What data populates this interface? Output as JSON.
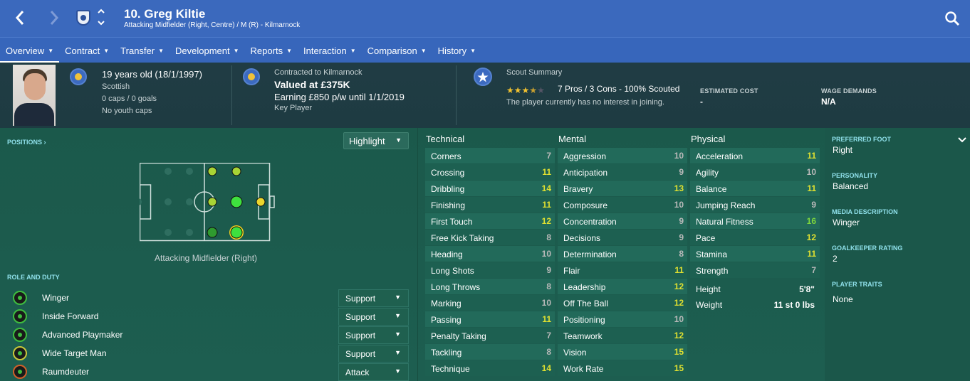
{
  "header": {
    "title": "10. Greg Kiltie",
    "subtitle": "Attacking Midfielder (Right, Centre) / M (R) - Kilmarnock",
    "back_icon": "chevron-left-icon",
    "forward_icon": "chevron-right-icon"
  },
  "tabs": [
    {
      "label": "Overview"
    },
    {
      "label": "Contract"
    },
    {
      "label": "Transfer"
    },
    {
      "label": "Development"
    },
    {
      "label": "Reports"
    },
    {
      "label": "Interaction"
    },
    {
      "label": "Comparison"
    },
    {
      "label": "History"
    }
  ],
  "info": {
    "age": "19 years old (18/1/1997)",
    "nationality": "Scottish",
    "caps": "0 caps / 0 goals",
    "youth_caps": "No youth caps",
    "contracted": "Contracted to Kilmarnock",
    "value": "Valued at £375K",
    "earning": "Earning £850 p/w until 1/1/2019",
    "status": "Key Player",
    "scout_title": "Scout Summary",
    "scout_rating": 3.5,
    "scout_rating_max": 5,
    "scout_line": "7 Pros / 3 Cons - 100% Scouted",
    "interest": "The player currently has no interest in joining.",
    "estimated_cost_label": "ESTIMATED COST",
    "estimated_cost": "-",
    "wage_label": "WAGE DEMANDS",
    "wage": "N/A"
  },
  "positions": {
    "header": "POSITIONS",
    "highlight": "Highlight",
    "caption": "Attacking Midfielder (Right)"
  },
  "roles": {
    "header": "ROLE AND DUTY",
    "items": [
      {
        "name": "Winger",
        "duty": "Support"
      },
      {
        "name": "Inside Forward",
        "duty": "Support"
      },
      {
        "name": "Advanced Playmaker",
        "duty": "Support"
      },
      {
        "name": "Wide Target Man",
        "duty": "Support"
      },
      {
        "name": "Raumdeuter",
        "duty": "Attack"
      }
    ]
  },
  "attributes": {
    "technical_label": "Technical",
    "mental_label": "Mental",
    "physical_label": "Physical",
    "technical": [
      {
        "name": "Corners",
        "value": "7"
      },
      {
        "name": "Crossing",
        "value": "11"
      },
      {
        "name": "Dribbling",
        "value": "14"
      },
      {
        "name": "Finishing",
        "value": "11"
      },
      {
        "name": "First Touch",
        "value": "12"
      },
      {
        "name": "Free Kick Taking",
        "value": "8"
      },
      {
        "name": "Heading",
        "value": "10"
      },
      {
        "name": "Long Shots",
        "value": "9"
      },
      {
        "name": "Long Throws",
        "value": "8"
      },
      {
        "name": "Marking",
        "value": "10"
      },
      {
        "name": "Passing",
        "value": "11"
      },
      {
        "name": "Penalty Taking",
        "value": "7"
      },
      {
        "name": "Tackling",
        "value": "8"
      },
      {
        "name": "Technique",
        "value": "14"
      }
    ],
    "mental": [
      {
        "name": "Aggression",
        "value": "10"
      },
      {
        "name": "Anticipation",
        "value": "9"
      },
      {
        "name": "Bravery",
        "value": "13"
      },
      {
        "name": "Composure",
        "value": "10"
      },
      {
        "name": "Concentration",
        "value": "9"
      },
      {
        "name": "Decisions",
        "value": "9"
      },
      {
        "name": "Determination",
        "value": "8"
      },
      {
        "name": "Flair",
        "value": "11"
      },
      {
        "name": "Leadership",
        "value": "12"
      },
      {
        "name": "Off The Ball",
        "value": "12"
      },
      {
        "name": "Positioning",
        "value": "10"
      },
      {
        "name": "Teamwork",
        "value": "12"
      },
      {
        "name": "Vision",
        "value": "15"
      },
      {
        "name": "Work Rate",
        "value": "15"
      }
    ],
    "physical": [
      {
        "name": "Acceleration",
        "value": "11"
      },
      {
        "name": "Agility",
        "value": "10"
      },
      {
        "name": "Balance",
        "value": "11"
      },
      {
        "name": "Jumping Reach",
        "value": "9"
      },
      {
        "name": "Natural Fitness",
        "value": "16"
      },
      {
        "name": "Pace",
        "value": "12"
      },
      {
        "name": "Stamina",
        "value": "11"
      },
      {
        "name": "Strength",
        "value": "7"
      }
    ],
    "height_label": "Height",
    "height": "5'8\"",
    "weight_label": "Weight",
    "weight": "11 st 0 lbs"
  },
  "right_panel": {
    "preferred_foot_label": "PREFERRED FOOT",
    "preferred_foot": "Right",
    "personality_label": "PERSONALITY",
    "personality": "Balanced",
    "media_label": "MEDIA DESCRIPTION",
    "media": "Winger",
    "gk_label": "GOALKEEPER RATING",
    "gk": "2",
    "traits_label": "PLAYER TRAITS",
    "traits": "None"
  },
  "colors": {
    "accent": "#3b69bd",
    "value_low": "#b9b9b9",
    "value_mid": "#e0e030",
    "value_high": "#7ed63d"
  }
}
